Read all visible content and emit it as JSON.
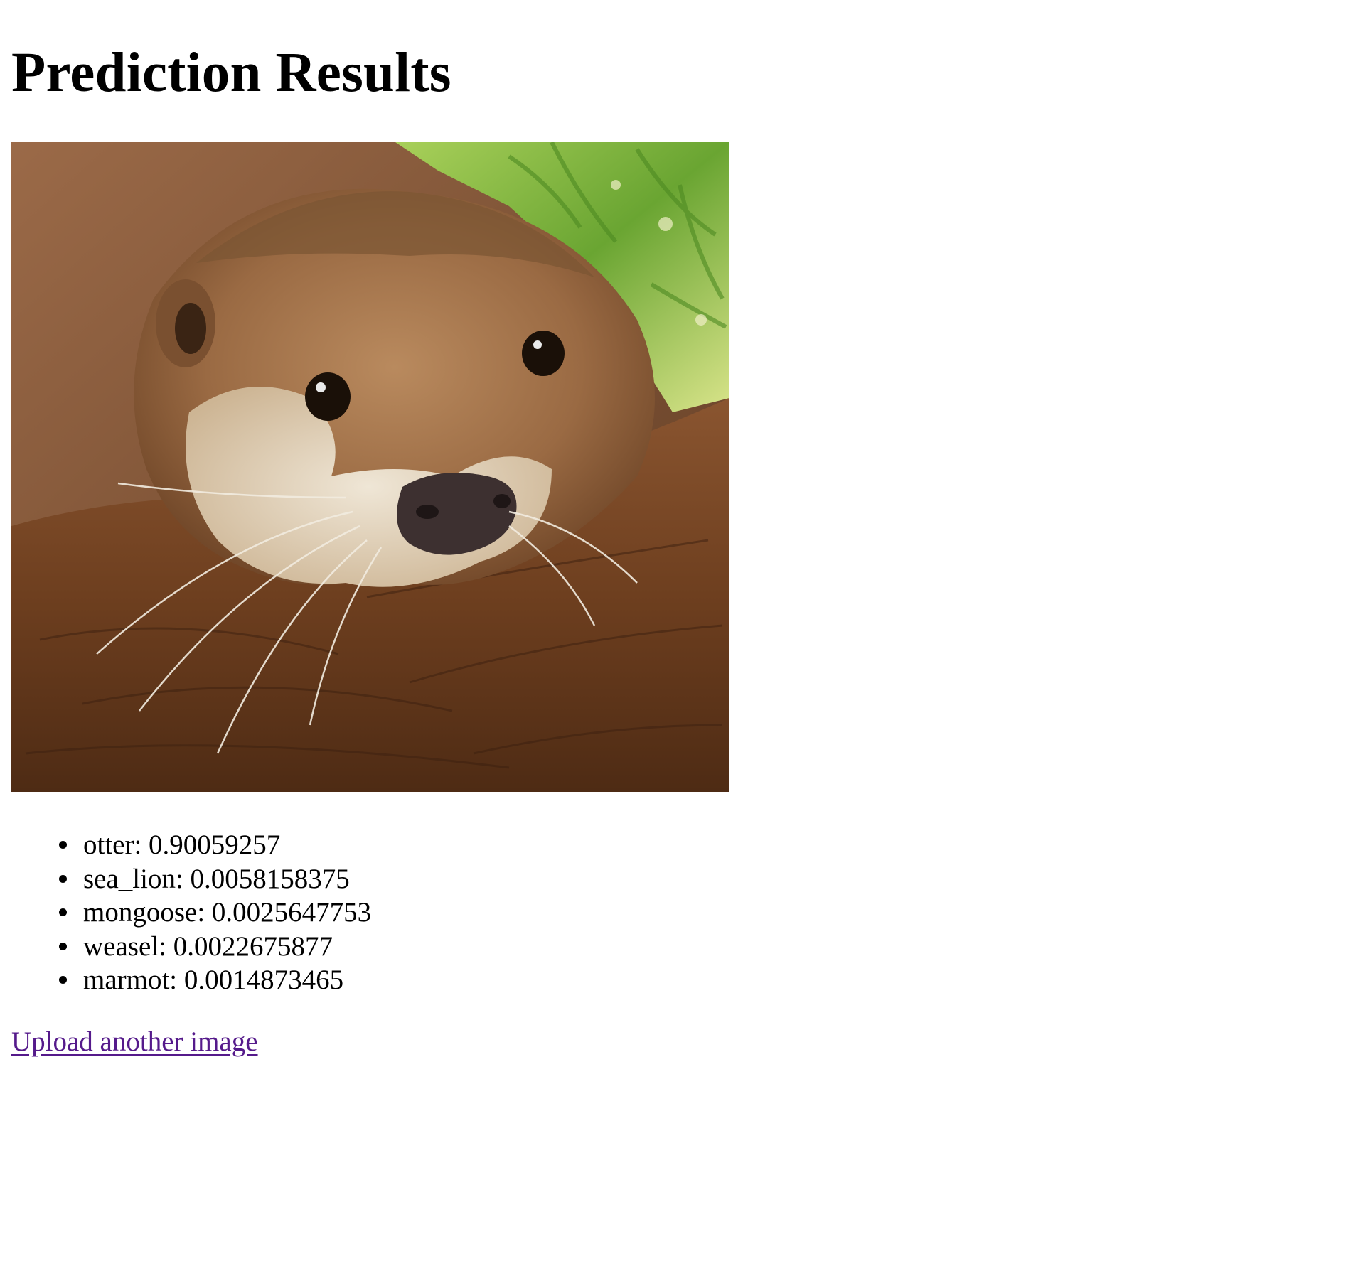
{
  "page": {
    "title": "Prediction Results"
  },
  "image": {
    "alt": "otter"
  },
  "predictions": [
    {
      "label": "otter",
      "score": "0.90059257",
      "text": "otter: 0.90059257"
    },
    {
      "label": "sea_lion",
      "score": "0.0058158375",
      "text": "sea_lion: 0.0058158375"
    },
    {
      "label": "mongoose",
      "score": "0.0025647753",
      "text": "mongoose: 0.0025647753"
    },
    {
      "label": "weasel",
      "score": "0.0022675877",
      "text": "weasel: 0.0022675877"
    },
    {
      "label": "marmot",
      "score": "0.0014873465",
      "text": "marmot: 0.0014873465"
    }
  ],
  "link": {
    "upload_label": "Upload another image"
  },
  "colors": {
    "link_visited": "#551a8b",
    "text": "#000000",
    "background": "#ffffff"
  }
}
